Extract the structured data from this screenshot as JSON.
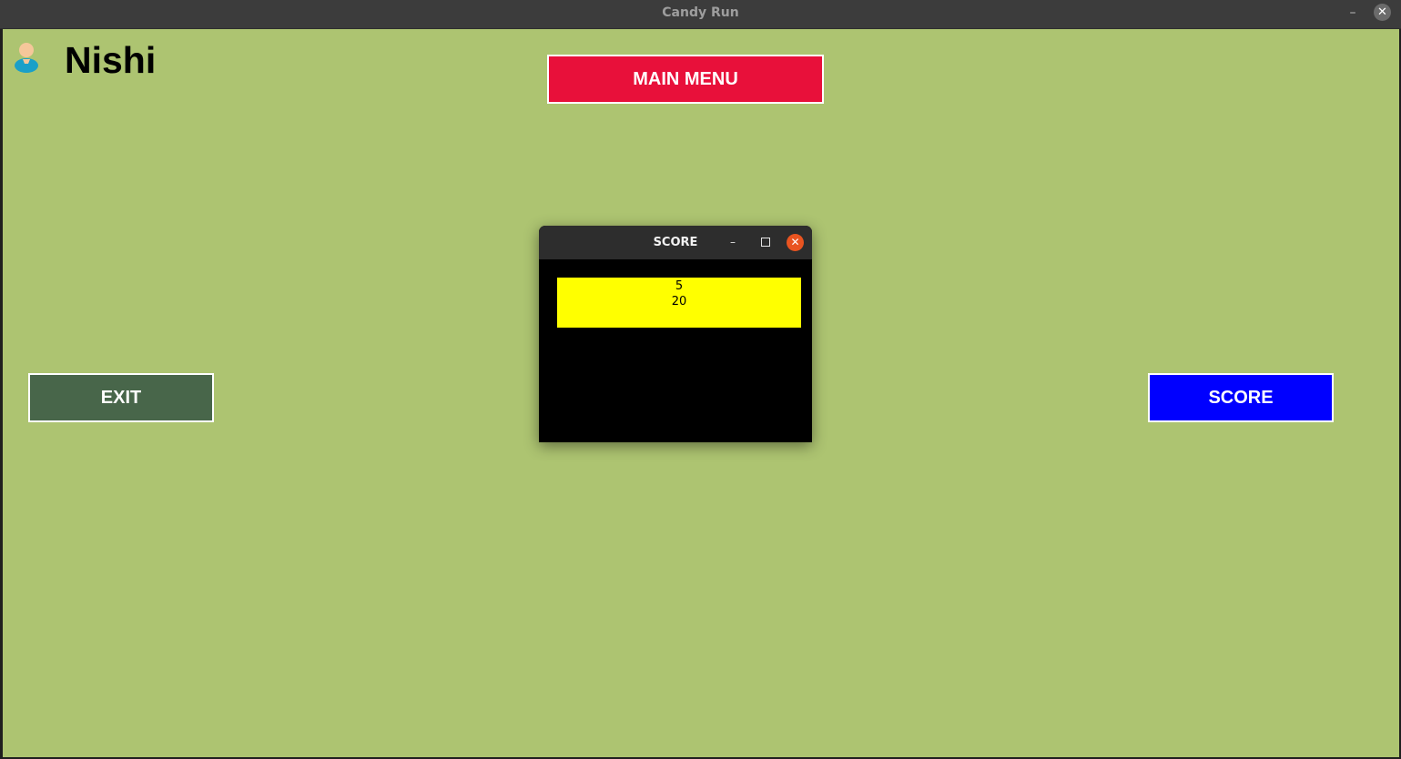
{
  "window": {
    "title": "Candy Run",
    "minimize_glyph": "–",
    "close_glyph": "✕"
  },
  "player": {
    "name": "Nishi",
    "icon": "user-avatar-icon"
  },
  "buttons": {
    "main_menu": "MAIN MENU",
    "exit": "EXIT",
    "score": "SCORE"
  },
  "colors": {
    "background": "#adc471",
    "main_menu_button": "#e8103a",
    "exit_button": "#48664a",
    "score_button": "#0000ff",
    "score_box": "#ffff00",
    "dialog_close": "#e95420"
  },
  "score_dialog": {
    "title": "SCORE",
    "minimize_glyph": "–",
    "close_glyph": "✕",
    "scores": [
      "5",
      "20"
    ]
  }
}
